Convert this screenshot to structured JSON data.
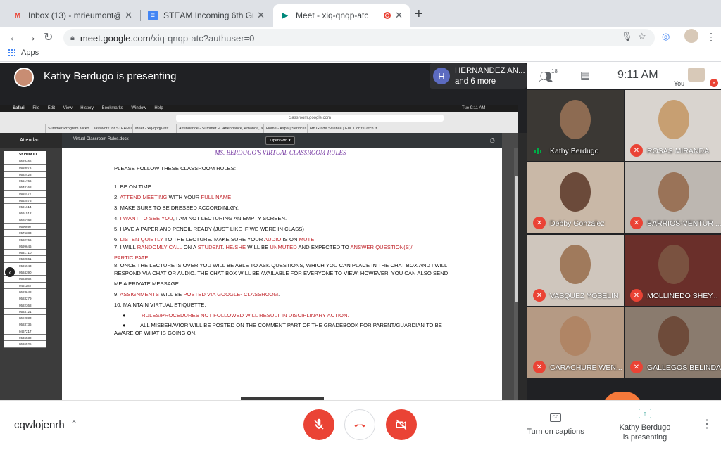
{
  "browser": {
    "tabs": [
      {
        "label": "Inbox (13) - mrieumont@mccs",
        "icon": "gmail-icon",
        "active": false
      },
      {
        "label": "STEAM Incoming 6th Grade - ",
        "icon": "docs-icon",
        "active": false
      },
      {
        "label": "Meet - xiq-qnqp-atc",
        "icon": "meet-icon",
        "active": true
      }
    ],
    "url_host": "meet.google.com",
    "url_path": "/xiq-qnqp-atc?authuser=0",
    "bookmarks_apps": "Apps"
  },
  "presenter": {
    "banner": "Kathy Berdugo is presenting",
    "others_initial": "H",
    "others_name": "HERNANDEZ AN...",
    "others_more": "and 6 more"
  },
  "top_right": {
    "people_count": "18",
    "time": "9:11 AM",
    "you_label": "You"
  },
  "shared_screen": {
    "mac_menu": [
      "Safari",
      "File",
      "Edit",
      "View",
      "History",
      "Bookmarks",
      "Window",
      "Help"
    ],
    "mac_clock": "Tue 9:11 AM",
    "inner_url": "classroom.google.com",
    "inner_tabs": [
      "Summer Program Kickoff",
      "Classwork for STEAM Inco...",
      "Meet - xiq-qnqp-atc",
      "Attendance - Summer Prog...",
      "Attendance, Amanda, and...",
      "Home - Aspa | Services | S...",
      "6th Grade Science | Educatin",
      "Don't Catch It"
    ],
    "sheet_title": "Attendan",
    "sheet_header": "Student ID",
    "sheet_ids": [
      "0583465",
      "0569972",
      "0582428",
      "0551766",
      "0548168",
      "0592477",
      "0562576",
      "0591614",
      "0591512",
      "0565398",
      "0596697",
      "0576383",
      "0582766",
      "0599646",
      "0531710",
      "0582861",
      "0596943",
      "0584390",
      "0583862",
      "0461182",
      "0583648",
      "0583279",
      "0582368",
      "0583721",
      "0552883",
      "0583736",
      "0467217",
      "0536530",
      "0526525"
    ],
    "doc_name": "Virtual Classroom Rules.docx",
    "open_with": "Open with",
    "doc_title": "MS. BERDUGO'S VIRTUAL CLASSROOM RULES",
    "intro": "PLEASE FOLLOW THESE CLASSROOM RULES:",
    "rules": {
      "r1": "1. BE ON TIME",
      "r2a": "2. ",
      "r2b": "ATTEND MEETING",
      "r2c": " WITH YOUR ",
      "r2d": "FULL NAME",
      "r3": "3. MAKE SURE TO BE DRESSED ACCORDINLGY.",
      "r4a": "4. ",
      "r4b": "I WANT TO SEE YOU",
      "r4c": ", I AM NOT LECTURING AN EMPTY SCREEN.",
      "r5": "5. HAVE A PAPER AND PENCIL READY (JUST LIKE IF WE WERE IN CLASS)",
      "r6a": "6. ",
      "r6b": "LISTEN QUIETLY",
      "r6c": " TO THE LECTURE. MAKE SURE YOUR ",
      "r6d": "AUDIO",
      "r6e": " IS ON ",
      "r6f": "MUTE",
      "r7a": "7. I WILL ",
      "r7b": "RANDOMLY CALL",
      "r7c": " ON A ",
      "r7d": "STUDENT",
      "r7e": ". ",
      "r7f": "HE/SHE",
      "r7g": " WILL BE ",
      "r7h": "UNMUTED",
      "r7i": " AND EXPECTED TO ",
      "r7j": "ANSWER QUESTION(S)/",
      "r7k": "PARTICIPATE",
      "r8a": "8. ONCE THE LECTURE IS OVER YOU WILL BE ABLE TO ASK QUESTIONS, WHICH YOU CAN PLACE IN THE CHAT BOX AND I WILL",
      "r8b": "RESPOND VIA CHAT OR AUDIO. THE CHAT BOX WILL BE AVAILABLE FOR EVERYONE TO VIEW; HOWEVER, YOU CAN ALSO SEND",
      "r8c": "ME A PRIVATE MESSAGE.",
      "r9a": "9. ",
      "r9b": "ASSIGNMENTS",
      "r9c": " WILL BE ",
      "r9d": "POSTED VIA GOOGLE- CLASSROOM",
      "r10": "10. MAINTAIN VIRTUAL ETIQUETTE.",
      "b1": "RULES/PROCEDURES NOT FOLLOWED WILL RESULT IN DISCIPLINARY ACTION.",
      "b2a": "ALL MISBEHAVIOR WILL BE POSTED ON THE COMMENT PART OF THE GRADEBOOK FOR PARENT/GUARDIAN TO BE",
      "b2b": "AWARE OF WHAT IS GOING ON."
    }
  },
  "participants": [
    {
      "name": "Kathy Berdugo",
      "muted": false,
      "bg": "#3b3834"
    },
    {
      "name": "ROSAS MIRANDA",
      "muted": true,
      "bg": "#d9d4cf"
    },
    {
      "name": "Debby Gonzalez",
      "muted": true,
      "bg": "#c9b8a7"
    },
    {
      "name": "BARRIOS-VENTUR ...",
      "muted": true,
      "bg": "#bdb7b1"
    },
    {
      "name": "VASQUEZ YOSELIN",
      "muted": true,
      "bg": "#cfc6bd"
    },
    {
      "name": "MOLLINEDO SHEY...",
      "muted": true,
      "bg": "#6a2f2a"
    },
    {
      "name": "CARACHURE WEN...",
      "muted": true,
      "bg": "#b59a84"
    },
    {
      "name": "GALLEGOS BELINDA",
      "muted": true,
      "bg": "#8a7b6e"
    }
  ],
  "bottom": {
    "meeting_code": "cqwlojenrh",
    "captions": "Turn on captions",
    "presenting_line1": "Kathy Berdugo",
    "presenting_line2": "is presenting"
  },
  "colors": {
    "red": "#ea4335",
    "highlight": "#c1272d",
    "title_purple": "#7a3fa5"
  }
}
